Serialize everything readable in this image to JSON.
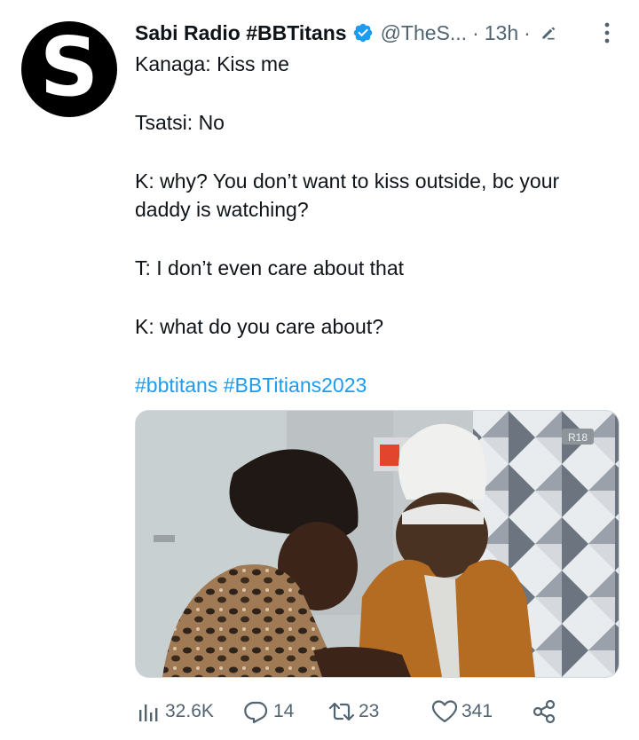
{
  "author": {
    "avatar_letter": "S",
    "name": "Sabi Radio #BBTitans",
    "handle": "@TheS...",
    "separator": "·",
    "time": "13h",
    "separator2": "·"
  },
  "tweet": {
    "lines": [
      "Kanaga: Kiss me",
      "Tsatsi: No",
      "K: why? You don’t want to kiss outside, bc your daddy is watching?",
      "T: I don’t even care about that",
      "K: what do you care about?"
    ],
    "hashtags": [
      "#bbtitans",
      "#BBTitians2023"
    ]
  },
  "media": {
    "rating_badge": "R18"
  },
  "actions": {
    "views": "32.6K",
    "replies": "14",
    "retweets": "23",
    "likes": "341"
  },
  "colors": {
    "accent": "#1d9bf0",
    "muted": "#536471",
    "text": "#0f1419"
  }
}
